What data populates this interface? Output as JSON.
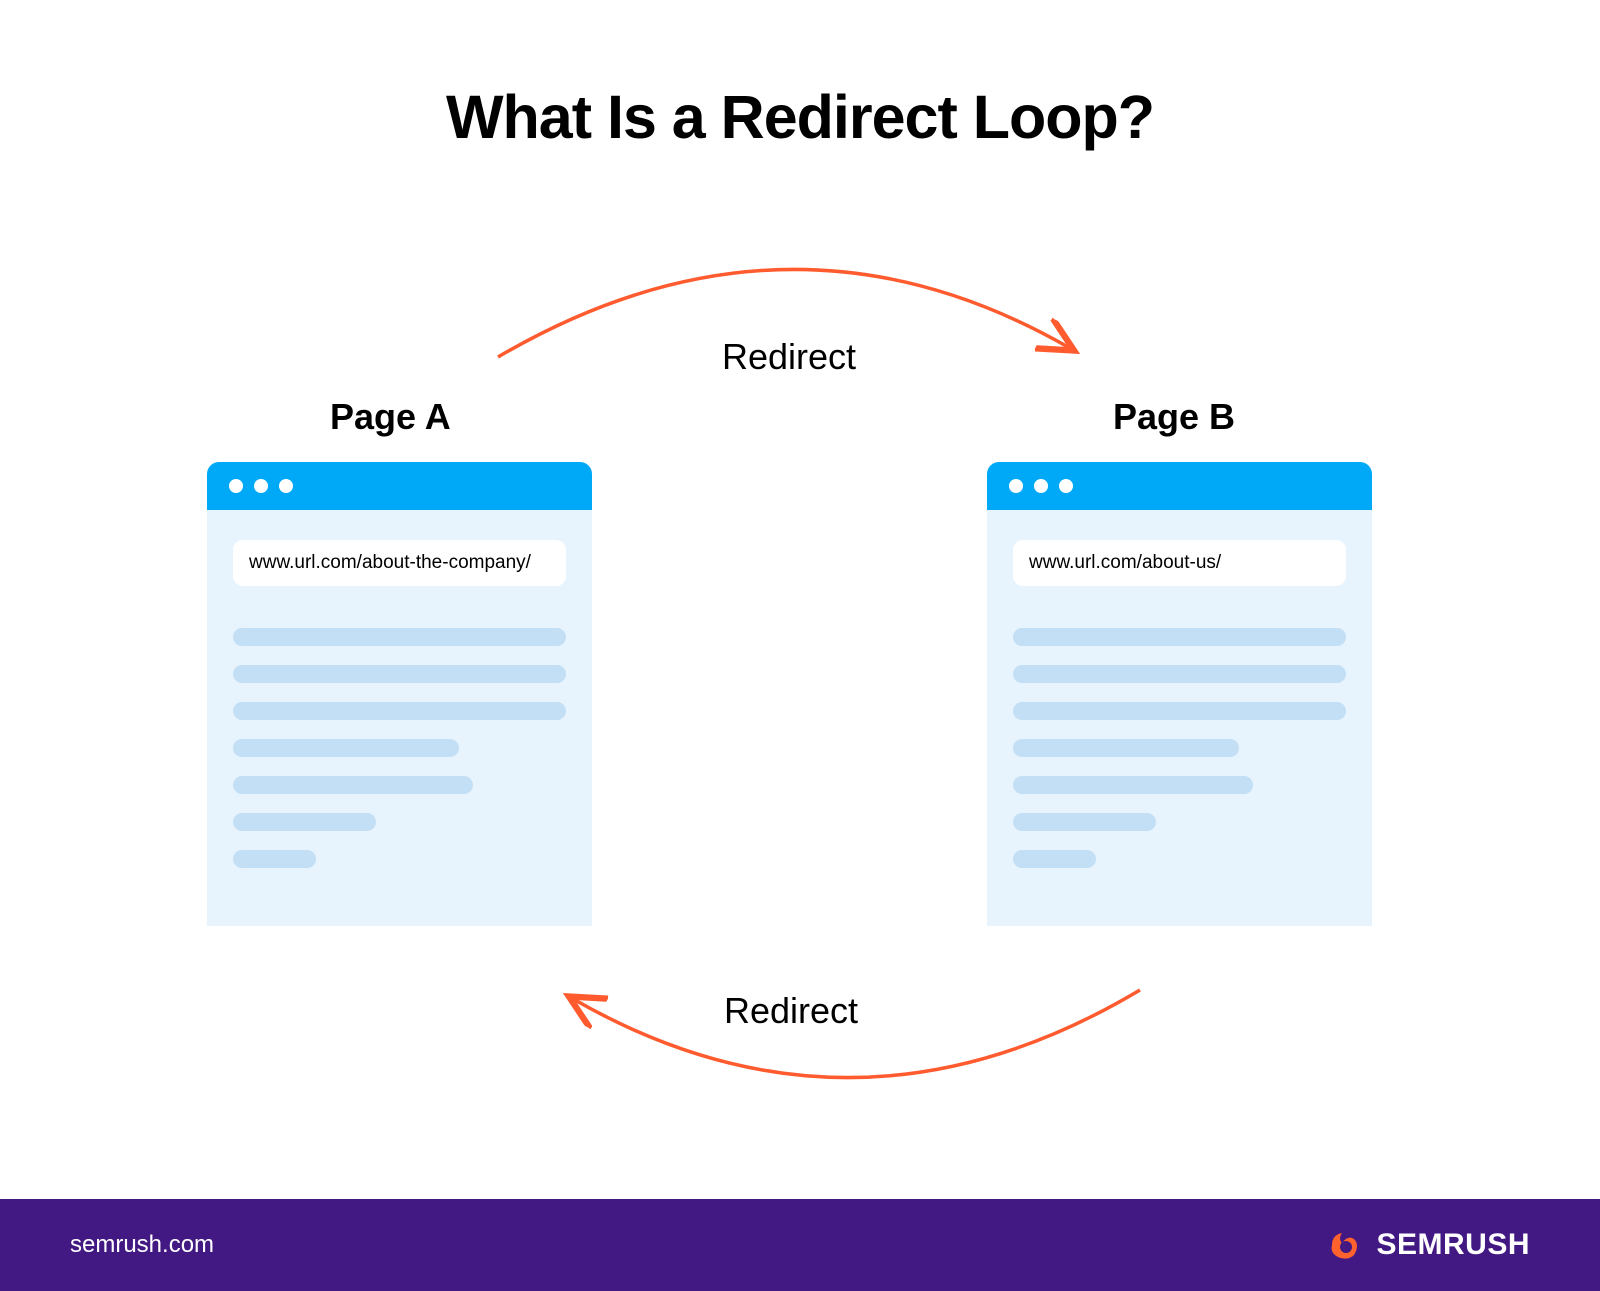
{
  "title": "What Is a Redirect Loop?",
  "pages": {
    "a": {
      "label": "Page A",
      "url": "www.url.com/about-the-company/"
    },
    "b": {
      "label": "Page B",
      "url": "www.url.com/about-us/"
    }
  },
  "labels": {
    "redirect_top": "Redirect",
    "redirect_bottom": "Redirect"
  },
  "footer": {
    "domain": "semrush.com",
    "brand": "SEMRUSH"
  },
  "colors": {
    "titlebar": "#00a9f7",
    "body": "#e8f4fd",
    "contentLine": "#c3dff5",
    "arrow": "#ff5b2e",
    "footer": "#421983"
  }
}
